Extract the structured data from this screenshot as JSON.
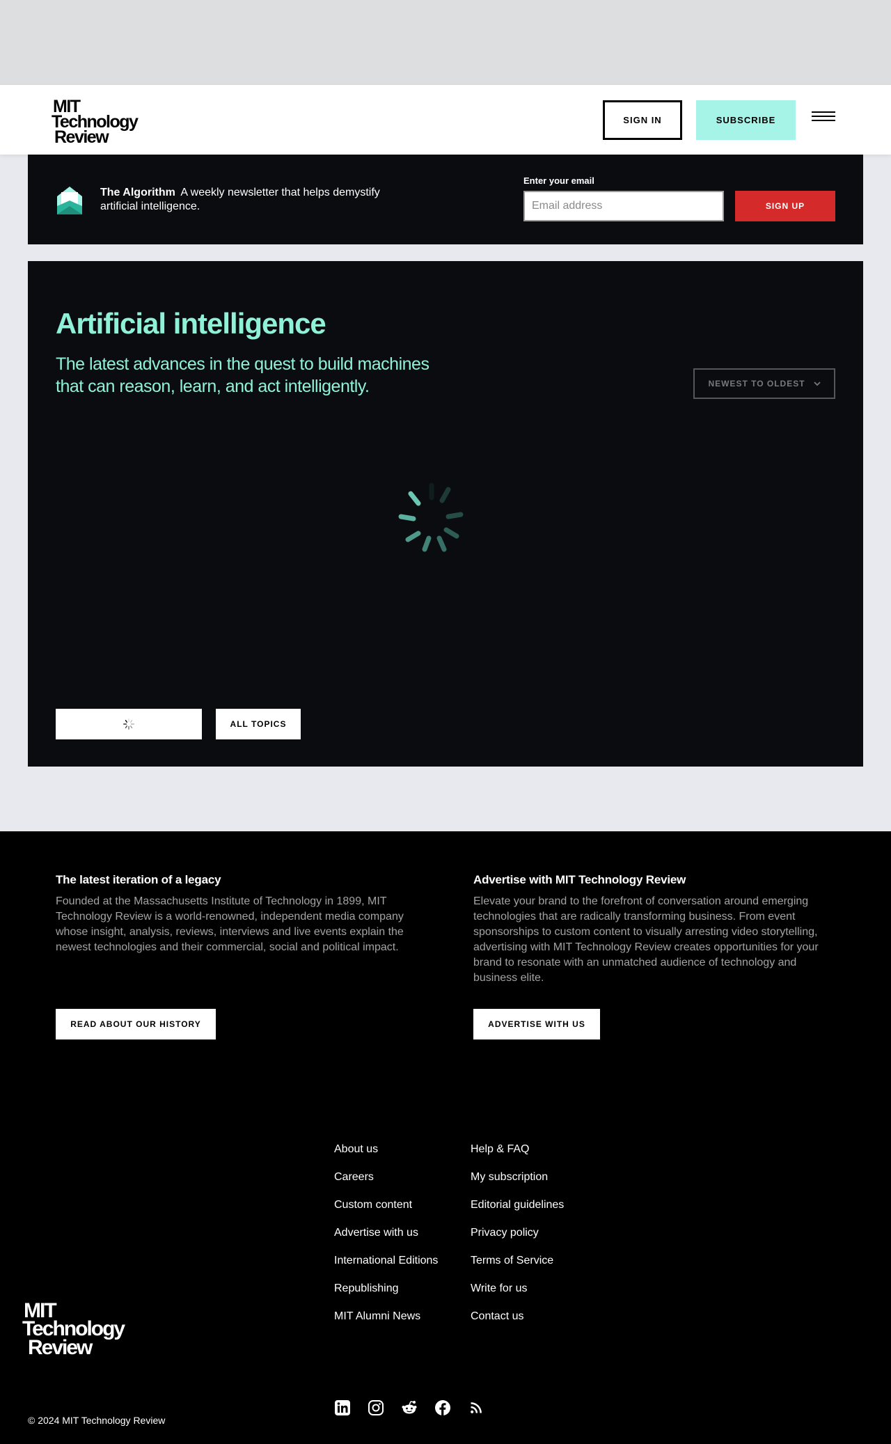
{
  "header": {
    "logo_lines": [
      "MIT",
      "Technology",
      "Review"
    ],
    "sign_in_label": "SIGN IN",
    "subscribe_label": "SUBSCRIBE"
  },
  "newsletter": {
    "name": "The Algorithm",
    "description": "A weekly newsletter that helps demystify artificial intelligence.",
    "email_label": "Enter your email",
    "email_placeholder": "Email address",
    "email_value": "",
    "signup_label": "SIGN UP"
  },
  "topic": {
    "title": "Artificial intelligence",
    "subtitle": "The latest advances in the quest to build machines that can reason, learn, and act intelligently.",
    "sort_value": "NEWEST TO OLDEST",
    "all_topics_label": "ALL TOPICS"
  },
  "footer": {
    "legacy": {
      "heading": "The latest iteration of a legacy",
      "body": "Founded at the Massachusetts Institute of Technology in 1899, MIT Technology Review is a world-renowned, independent media company whose insight, analysis, reviews, interviews and live events explain the newest technologies and their commercial, social and political impact.",
      "button": "READ ABOUT OUR HISTORY"
    },
    "advertise": {
      "heading": "Advertise with MIT Technology Review",
      "body": "Elevate your brand to the forefront of conversation around emerging technologies that are radically transforming business. From event sponsorships to custom content to visually arresting video storytelling, advertising with MIT Technology Review creates opportunities for your brand to resonate with an unmatched audience of technology and business elite.",
      "button": "ADVERTISE WITH US"
    },
    "links_col1": [
      "About us",
      "Careers",
      "Custom content",
      "Advertise with us",
      "International Editions",
      "Republishing",
      "MIT Alumni News"
    ],
    "links_col2": [
      "Help & FAQ",
      "My subscription",
      "Editorial guidelines",
      "Privacy policy",
      "Terms of Service",
      "Write for us",
      "Contact us"
    ],
    "logo_lines": [
      "MIT",
      "Technology",
      "Review"
    ],
    "social_icons": [
      "linkedin-icon",
      "instagram-icon",
      "reddit-icon",
      "facebook-icon",
      "rss-icon"
    ],
    "copyright": "© 2024 MIT Technology Review"
  },
  "colors": {
    "accent_mint": "#a6f3e7",
    "topic_text": "#8ff2d8",
    "signup_red": "#d42a2a",
    "panel_dark": "#0b0c10"
  }
}
